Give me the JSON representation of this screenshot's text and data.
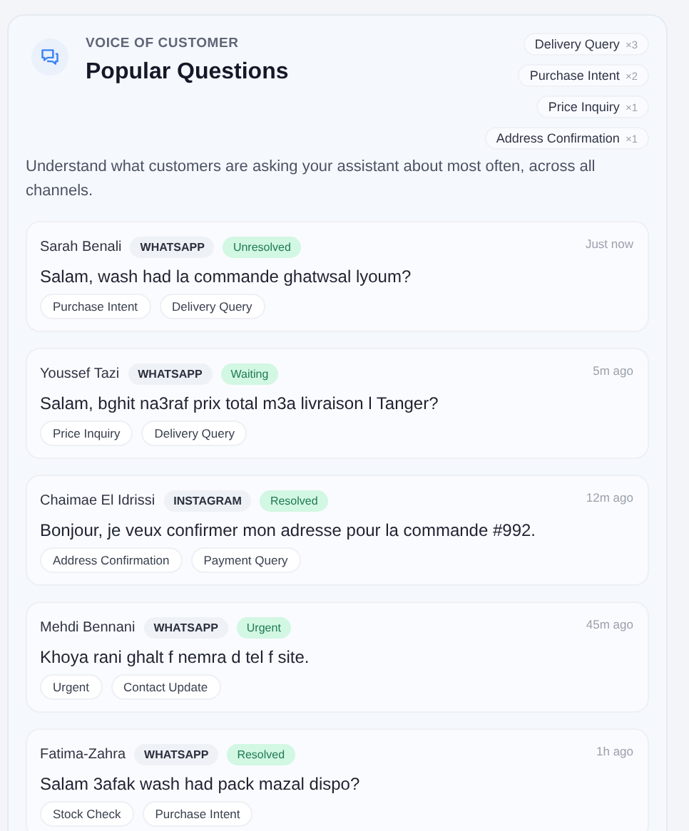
{
  "header": {
    "eyebrow": "VOICE OF CUSTOMER",
    "title": "Popular Questions",
    "description": "Understand what customers are asking your assistant about most often, across all channels.",
    "topics": [
      {
        "label": "Delivery Query",
        "count": "×3"
      },
      {
        "label": "Purchase Intent",
        "count": "×2"
      },
      {
        "label": "Price Inquiry",
        "count": "×1"
      },
      {
        "label": "Address Confirmation",
        "count": "×1"
      }
    ]
  },
  "questions": [
    {
      "name": "Sarah Benali",
      "channel": "WHATSAPP",
      "status": "Unresolved",
      "time": "Just now",
      "message": "Salam, wash had la commande ghatwsal lyoum?",
      "tags": [
        "Purchase Intent",
        "Delivery Query"
      ]
    },
    {
      "name": "Youssef Tazi",
      "channel": "WHATSAPP",
      "status": "Waiting",
      "time": "5m ago",
      "message": "Salam, bghit na3raf prix total m3a livraison l Tanger?",
      "tags": [
        "Price Inquiry",
        "Delivery Query"
      ]
    },
    {
      "name": "Chaimae El Idrissi",
      "channel": "INSTAGRAM",
      "status": "Resolved",
      "time": "12m ago",
      "message": "Bonjour, je veux confirmer mon adresse pour la commande #992.",
      "tags": [
        "Address Confirmation",
        "Payment Query"
      ]
    },
    {
      "name": "Mehdi Bennani",
      "channel": "WHATSAPP",
      "status": "Urgent",
      "time": "45m ago",
      "message": "Khoya rani ghalt f nemra d tel f site.",
      "tags": [
        "Urgent",
        "Contact Update"
      ]
    },
    {
      "name": "Fatima-Zahra",
      "channel": "WHATSAPP",
      "status": "Resolved",
      "time": "1h ago",
      "message": "Salam 3afak wash had pack mazal dispo?",
      "tags": [
        "Stock Check",
        "Purchase Intent"
      ]
    }
  ]
}
